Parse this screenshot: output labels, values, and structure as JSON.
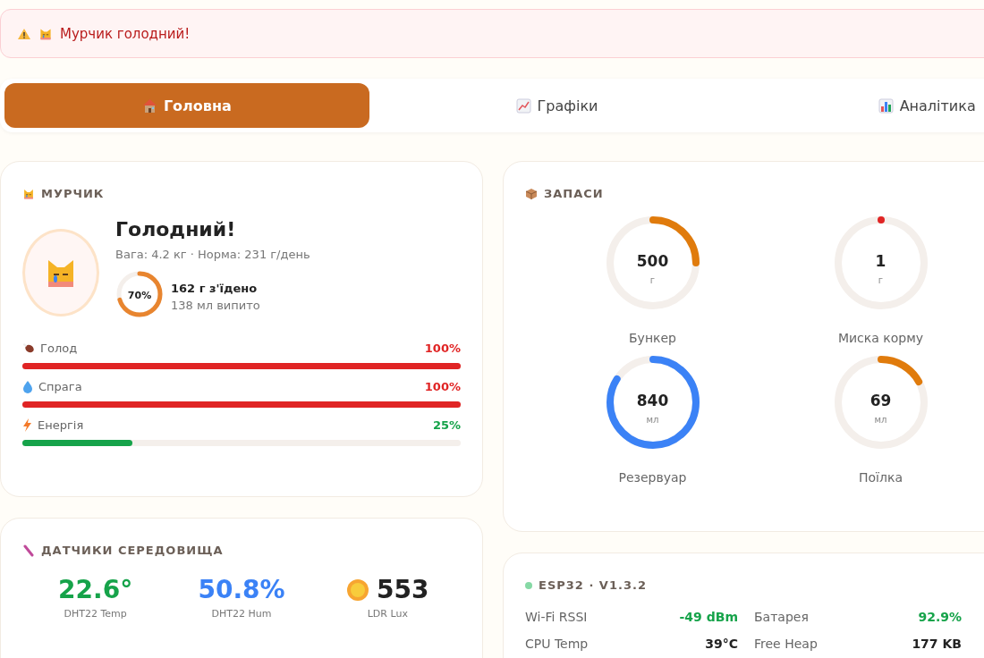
{
  "alert": {
    "text": "Мурчик голодний!"
  },
  "tabs": [
    {
      "label": "Головна",
      "selected": true,
      "kind": "home"
    },
    {
      "label": "Графіки",
      "selected": false,
      "kind": "chart"
    },
    {
      "label": "Аналітика",
      "selected": false,
      "kind": "bars"
    }
  ],
  "pet": {
    "title": "МУРЧИК",
    "status": "Голодний!",
    "info": "Вага: 4.2 кг · Норма: 231 г/день",
    "ring": {
      "label": "70%"
    },
    "eaten": "162 г з'їдено",
    "drunk": "138 мл випито",
    "bars": [
      {
        "kind": "food",
        "label": "Голод",
        "value": "100%",
        "level": 1,
        "color": "#e02424"
      },
      {
        "kind": "water",
        "label": "Спрага",
        "value": "100%",
        "level": 1,
        "color": "#e02424"
      },
      {
        "kind": "energy",
        "label": "Енергія",
        "value": "25%",
        "level": 0.25,
        "color": "#16a34a"
      }
    ]
  },
  "supplies": {
    "title": "ЗАПАСИ",
    "gauges": [
      {
        "value": "500",
        "unit": "г",
        "label": "Бункер",
        "level": 0.25,
        "color": "#e07b0c"
      },
      {
        "value": "1",
        "unit": "г",
        "label": "Миска корму",
        "level": 0.0,
        "color": "#e02424"
      },
      {
        "value": "840",
        "unit": "мл",
        "label": "Резервуар",
        "level": 0.84,
        "color": "#3b82f6"
      },
      {
        "value": "69",
        "unit": "мл",
        "label": "Поїлка",
        "level": 0.17,
        "color": "#e07b0c"
      }
    ]
  },
  "sensors": {
    "title": "ДАТЧИКИ СЕРЕДОВИЩА",
    "items": [
      {
        "kind": "plain",
        "value": "22.6°",
        "label": "DHT22 Temp",
        "color": "#16a34a"
      },
      {
        "kind": "plain",
        "value": "50.8%",
        "label": "DHT22 Hum",
        "color": "#3b82f6"
      },
      {
        "kind": "sun",
        "value": "553",
        "label": "LDR Lux",
        "color": "#222222"
      }
    ]
  },
  "device": {
    "title": "ESP32 · V1.3.2",
    "online": true,
    "stats": [
      {
        "label": "Wi-Fi RSSI",
        "value": "-49 dBm",
        "color": "#16a34a"
      },
      {
        "label": "Батарея",
        "value": "92.9%",
        "color": "#16a34a"
      },
      {
        "label": "CPU Temp",
        "value": "39°C",
        "color": "#222222"
      },
      {
        "label": "Free Heap",
        "value": "177 KB",
        "color": "#222222"
      }
    ]
  }
}
